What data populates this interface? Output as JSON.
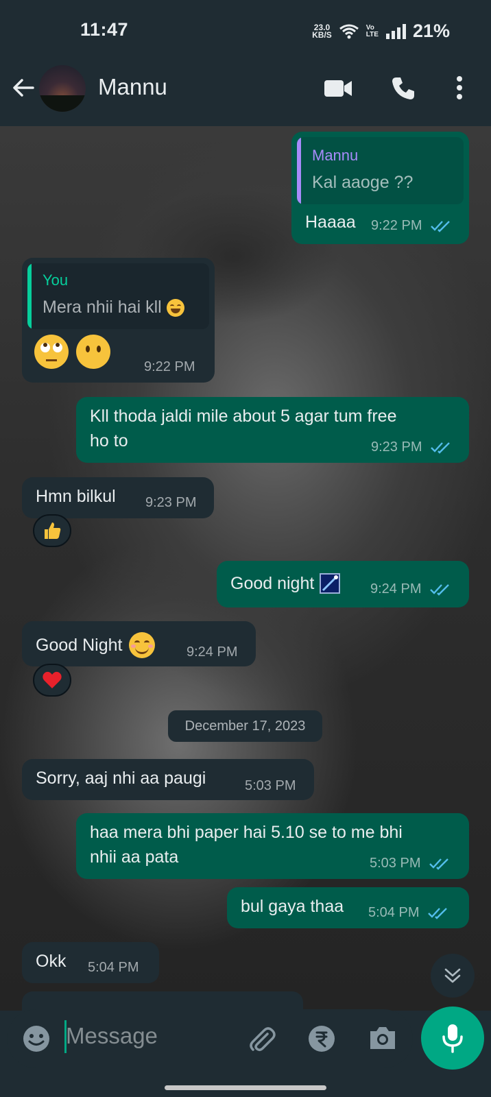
{
  "status_bar": {
    "time": "11:47",
    "net_speed_value": "23.0",
    "net_speed_unit": "KB/S",
    "volte_line1": "Vo",
    "volte_line2": "LTE",
    "battery": "21%"
  },
  "header": {
    "contact_name": "Mannu"
  },
  "messages": [
    {
      "dir": "out",
      "quote_name": "Mannu",
      "quote_text": "Kal aaoge ??",
      "text": "Haaaa",
      "time": "9:22 PM"
    },
    {
      "dir": "in",
      "quote_name": "You",
      "quote_text": "Mera nhii hai kll",
      "time": "9:22 PM"
    },
    {
      "dir": "out",
      "text_line1": "Kll thoda jaldi mile about 5 agar tum free",
      "text_line2": "ho to",
      "time": "9:23 PM"
    },
    {
      "dir": "in",
      "text": "Hmn bilkul",
      "time": "9:23 PM",
      "reaction": "thumbs-up"
    },
    {
      "dir": "out",
      "text": "Good night",
      "time": "9:24 PM"
    },
    {
      "dir": "in",
      "text": "Good Night",
      "time": "9:24 PM",
      "reaction": "heart"
    },
    {
      "dir": "in",
      "text": "Sorry, aaj nhi aa paugi",
      "time": "5:03 PM"
    },
    {
      "dir": "out",
      "text_line1": "haa mera bhi paper hai 5.10 se to me bhi",
      "text_line2": "nhii aa pata",
      "time": "5:03 PM"
    },
    {
      "dir": "out",
      "text": "bul gaya thaa",
      "time": "5:04 PM"
    },
    {
      "dir": "in",
      "text": "Okk",
      "time": "5:04 PM"
    }
  ],
  "date_divider": "December 17, 2023",
  "composer": {
    "placeholder": "Message"
  },
  "colors": {
    "outgoing_bubble": "#005c4b",
    "incoming_bubble": "#1f2c33",
    "accent": "#00a884",
    "read_ticks": "#53bdeb",
    "quote_name_purple": "#a78bfa",
    "quote_name_green": "#06cf9c"
  }
}
